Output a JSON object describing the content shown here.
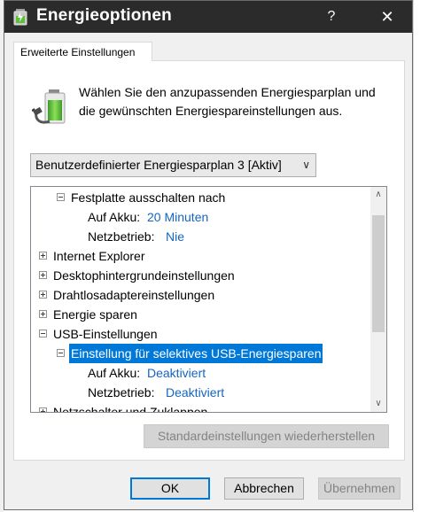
{
  "window": {
    "title": "Energieoptionen",
    "help_glyph": "?",
    "close_glyph": "✕"
  },
  "tab": {
    "label": "Erweiterte Einstellungen"
  },
  "description": "Wählen Sie den anzupassenden Energiesparplan und die gewünschten Energiespareinstellungen aus.",
  "plan_select": {
    "value": "Benutzerdefinierter Energiesparplan 3 [Aktiv]"
  },
  "tree": {
    "rows": [
      {
        "label": "Festplatte ausschalten nach",
        "expanded": true
      },
      {
        "label": "Auf Akku:",
        "value": "20 Minuten"
      },
      {
        "label": "Netzbetrieb:",
        "value": "Nie"
      },
      {
        "label": "Internet Explorer",
        "expanded": false
      },
      {
        "label": "Desktophintergrundeinstellungen",
        "expanded": false
      },
      {
        "label": "Drahtlosadaptereinstellungen",
        "expanded": false
      },
      {
        "label": "Energie sparen",
        "expanded": false
      },
      {
        "label": "USB-Einstellungen",
        "expanded": true
      },
      {
        "label": "Einstellung für selektives USB-Energiesparen",
        "expanded": true,
        "selected": true
      },
      {
        "label": "Auf Akku:",
        "value": "Deaktiviert"
      },
      {
        "label": "Netzbetrieb:",
        "value": "Deaktiviert"
      },
      {
        "label": "Netzschalter und Zuklappen",
        "expanded": false
      }
    ]
  },
  "buttons": {
    "restore": "Standardeinstellungen wiederherstellen",
    "ok": "OK",
    "cancel": "Abbrechen",
    "apply": "Übernehmen"
  },
  "colors": {
    "titlebar": "#2b2b2b",
    "selection": "#0078d7",
    "link_value": "#1565c0"
  }
}
